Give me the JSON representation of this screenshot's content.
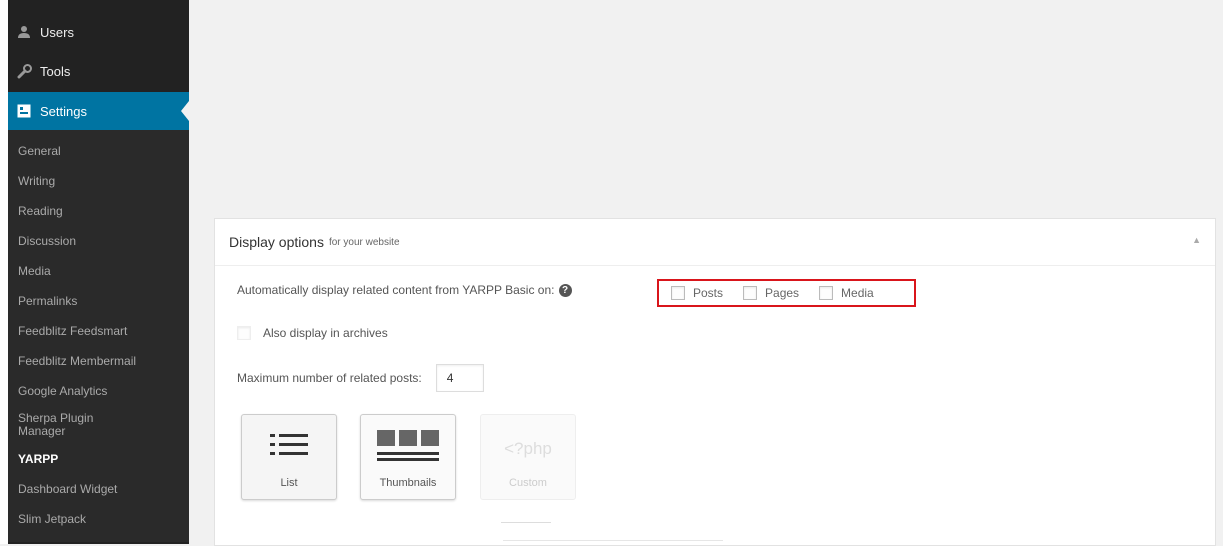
{
  "sidebar": {
    "top_items": [
      {
        "label": "Users",
        "icon": "users-icon"
      },
      {
        "label": "Tools",
        "icon": "tools-icon"
      },
      {
        "label": "Settings",
        "icon": "settings-icon",
        "active": true
      }
    ],
    "sub_items": [
      {
        "label": "General"
      },
      {
        "label": "Writing"
      },
      {
        "label": "Reading"
      },
      {
        "label": "Discussion"
      },
      {
        "label": "Media"
      },
      {
        "label": "Permalinks"
      },
      {
        "label": "Feedblitz Feedsmart"
      },
      {
        "label": "Feedblitz Membermail"
      },
      {
        "label": "Google Analytics"
      },
      {
        "label": "Sherpa Plugin Manager"
      },
      {
        "label": "YARPP",
        "current": true
      },
      {
        "label": "Dashboard Widget"
      },
      {
        "label": "Slim Jetpack"
      }
    ],
    "colors": {
      "background": "#222222",
      "active": "#0074a2"
    }
  },
  "panel": {
    "title": "Display options",
    "subtitle": "for your website",
    "toggle_icon": "collapse-arrow-icon",
    "auto_display": {
      "label": "Automatically display related content from YARPP Basic on:",
      "help_icon": "help-icon",
      "options": [
        {
          "label": "Posts",
          "checked": false
        },
        {
          "label": "Pages",
          "checked": false
        },
        {
          "label": "Media",
          "checked": false
        }
      ],
      "highlight_color": "#d9151b"
    },
    "archives": {
      "label": "Also display in archives",
      "checked": false
    },
    "max_posts": {
      "label": "Maximum number of related posts:",
      "value": "4"
    },
    "styles": [
      {
        "label": "List",
        "icon": "list-icon",
        "selected": true
      },
      {
        "label": "Thumbnails",
        "icon": "thumbnails-icon",
        "selected": false
      },
      {
        "label": "Custom",
        "glyph": "<?php",
        "disabled": true
      }
    ]
  }
}
